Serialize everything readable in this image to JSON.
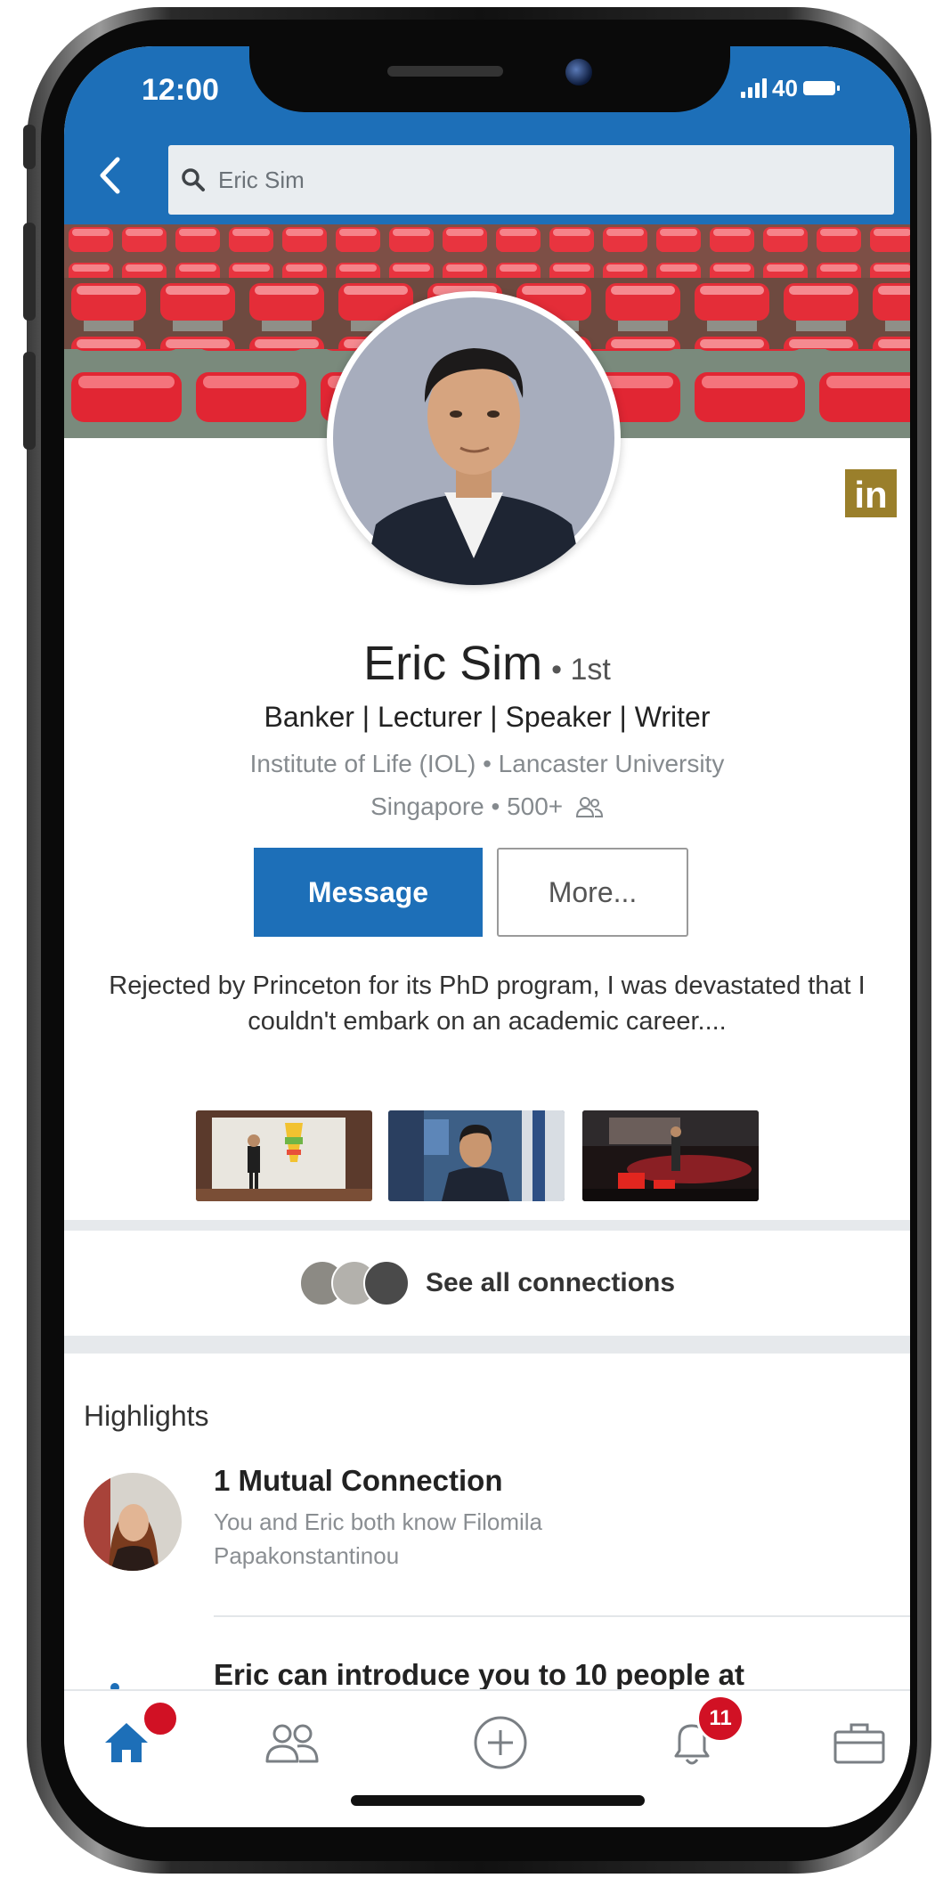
{
  "status_bar": {
    "time": "12:00",
    "network": "40"
  },
  "search": {
    "value": "Eric Sim"
  },
  "profile": {
    "name": "Eric Sim",
    "degree": "• 1st",
    "headline": "Banker | Lecturer | Speaker | Writer",
    "education_line": "Institute of Life (IOL) • Lancaster University",
    "location_line": "Singapore • 500+",
    "summary": "Rejected by Princeton for its PhD program, I was devastated that I couldn't embark on an academic career....",
    "badge_text": "in"
  },
  "actions": {
    "message_label": "Message",
    "more_label": "More..."
  },
  "connections": {
    "label": "See all connections"
  },
  "highlights": {
    "section_title": "Highlights",
    "items": [
      {
        "title": "1 Mutual Connection",
        "text": "You and Eric both know Filomila Papakonstantinou"
      },
      {
        "title": "Eric can introduce you to 10 people at"
      }
    ]
  },
  "tab_bar": {
    "home_badge": "",
    "notifications_badge": "11",
    "icons": [
      "home-icon",
      "my-network-icon",
      "post-icon",
      "notifications-icon",
      "jobs-icon"
    ]
  },
  "colors": {
    "brand_blue": "#1d6fb8",
    "badge_red": "#d11124",
    "linkedin_gold": "#9a7f2b"
  }
}
